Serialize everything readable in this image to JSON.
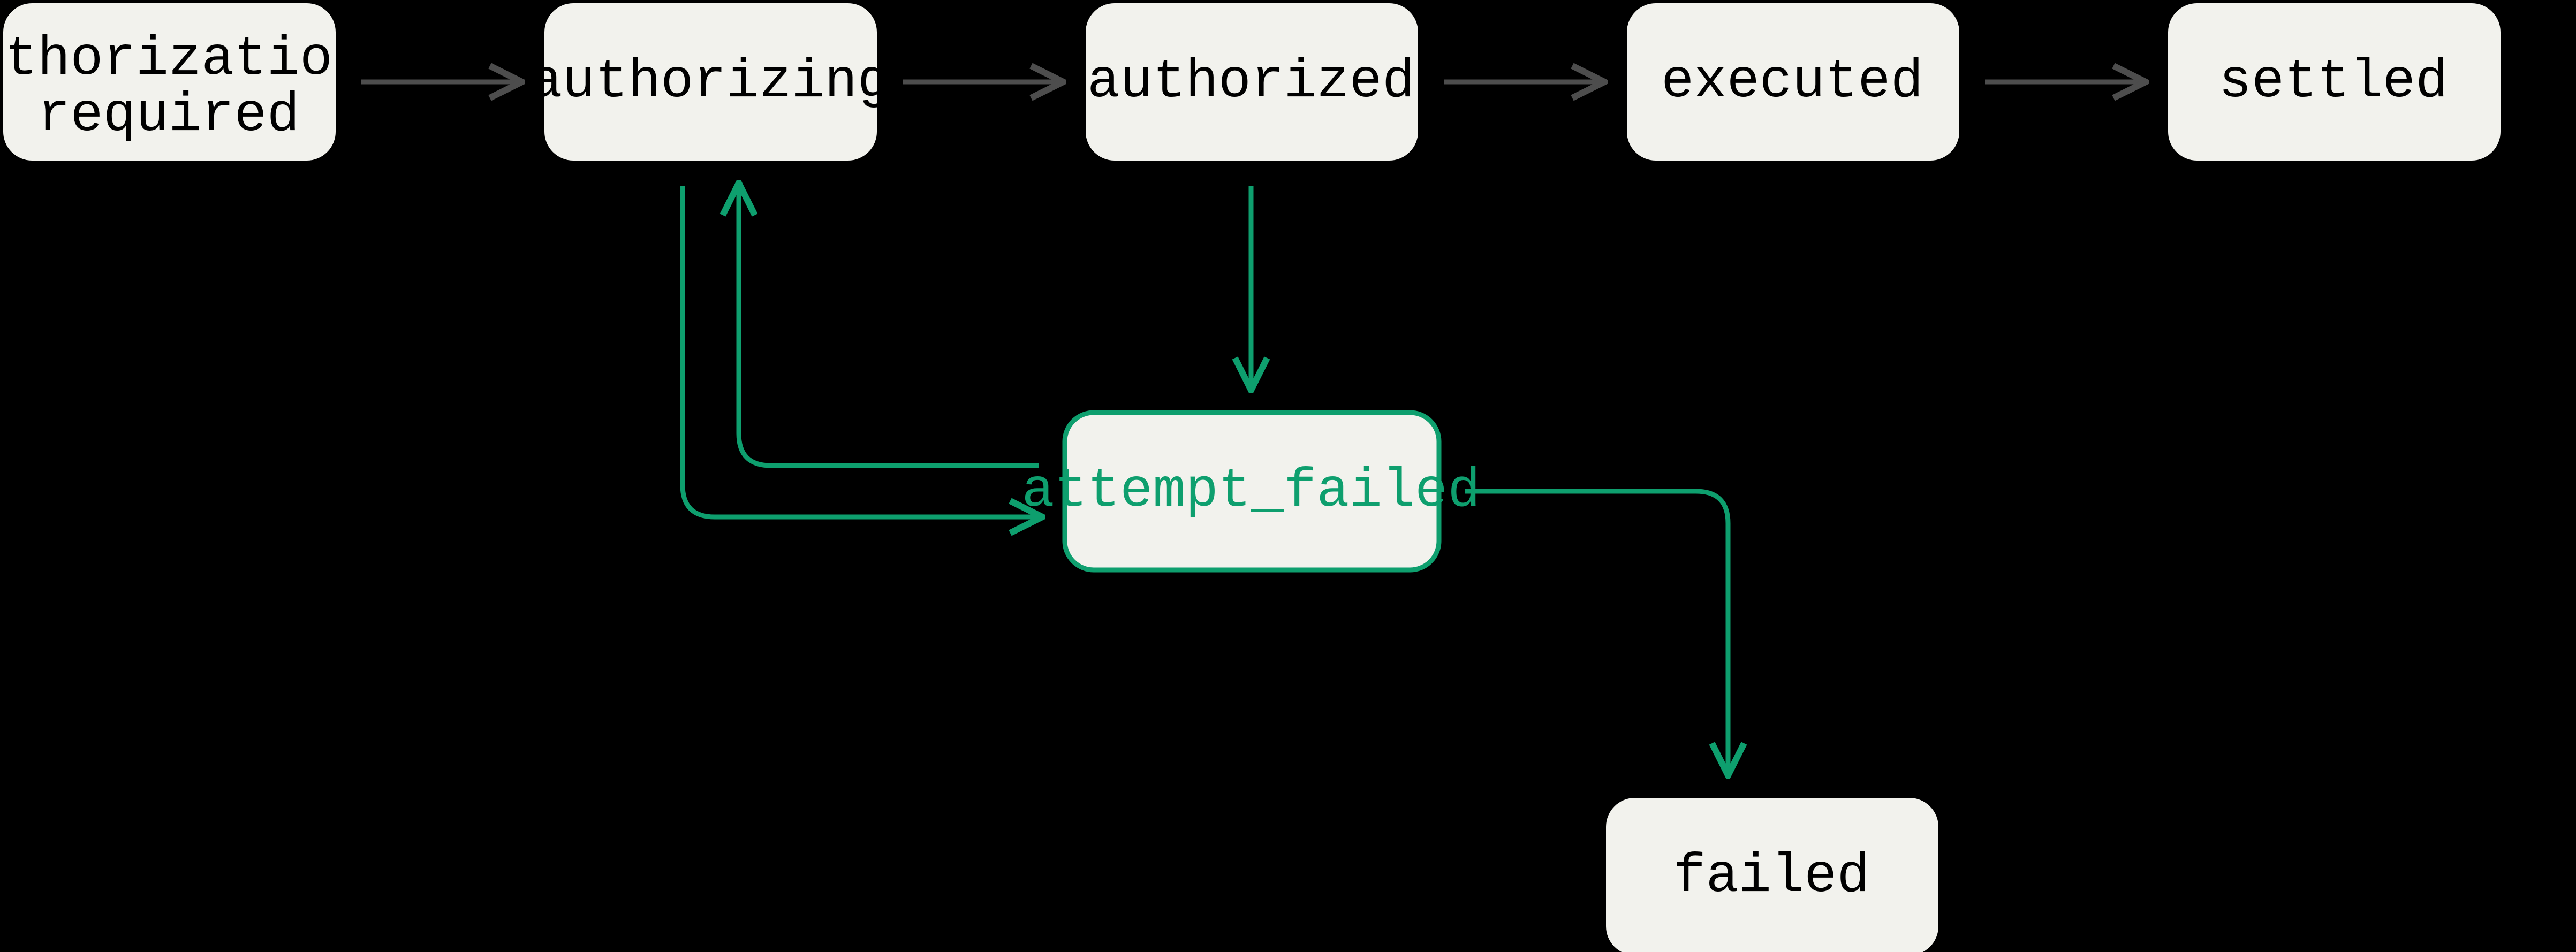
{
  "diagram": {
    "nodes": {
      "authorization_required": {
        "line1": "authorization_",
        "line2": "required"
      },
      "authorizing": {
        "label": "authorizing"
      },
      "authorized": {
        "label": "authorized"
      },
      "executed": {
        "label": "executed"
      },
      "settled": {
        "label": "settled"
      },
      "attempt_failed": {
        "label": "attempt_failed"
      },
      "failed": {
        "label": "failed"
      }
    },
    "edges": [
      {
        "from": "authorization_required",
        "to": "authorizing",
        "style": "gray"
      },
      {
        "from": "authorizing",
        "to": "authorized",
        "style": "gray"
      },
      {
        "from": "authorized",
        "to": "executed",
        "style": "gray"
      },
      {
        "from": "executed",
        "to": "settled",
        "style": "gray"
      },
      {
        "from": "authorized",
        "to": "attempt_failed",
        "style": "green"
      },
      {
        "from": "authorizing",
        "to": "attempt_failed",
        "style": "green"
      },
      {
        "from": "attempt_failed",
        "to": "authorizing",
        "style": "green"
      },
      {
        "from": "attempt_failed",
        "to": "failed",
        "style": "green"
      }
    ],
    "colors": {
      "background": "#000000",
      "node_fill": "#f2f2ed",
      "accent": "#0e9f6e",
      "arrow_gray": "#4d4d4d"
    }
  }
}
